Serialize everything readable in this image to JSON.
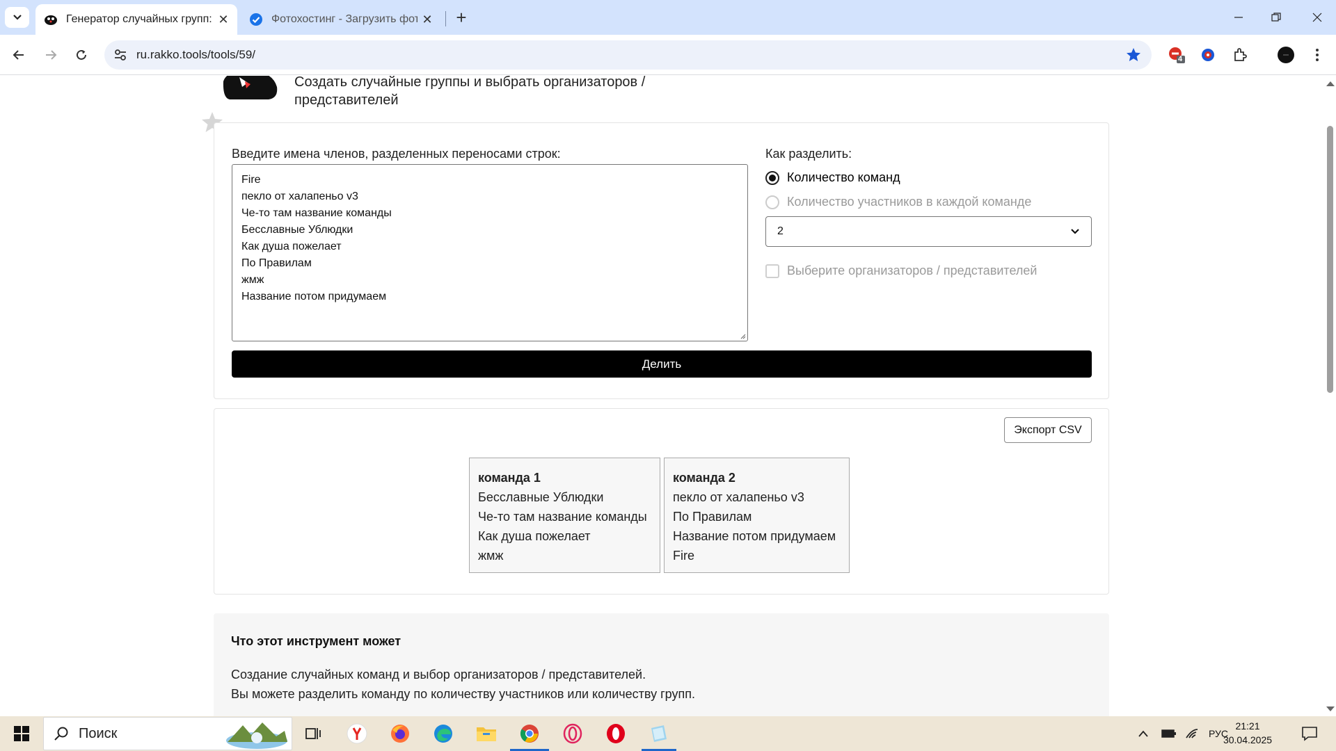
{
  "browser": {
    "tabs": [
      {
        "title": "Генератор случайных групп: б",
        "active": true
      },
      {
        "title": "Фотохостинг - Загрузить фото",
        "active": false
      }
    ],
    "url": "ru.rakko.tools/tools/59/",
    "extension_badge": "4"
  },
  "page": {
    "subtitle_line1": "Создать случайные группы и выбрать организаторов /",
    "subtitle_line2": "представителей",
    "form": {
      "names_label": "Введите имена членов, разделенных переносами строк:",
      "names": [
        "Fire",
        "пекло от халапеньо v3",
        "Че-то там название команды",
        "Бесславные Ублюдки",
        "Как душа пожелает",
        "По Правилам",
        "жмж",
        "Название потом придумаем"
      ],
      "split_label": "Как разделить:",
      "option_teams": "Количество команд",
      "option_members": "Количество участников в каждой команде",
      "selected_option": "Количество команд",
      "count_value": "2",
      "organizers_label": "Выберите организаторов / представителей",
      "organizers_checked": false,
      "divide_button": "Делить"
    },
    "result": {
      "export_button": "Экспорт CSV",
      "teams": [
        {
          "name": "команда 1",
          "members": [
            "Бесславные Ублюдки",
            "Че-то там название команды",
            "Как душа пожелает",
            "жмж"
          ]
        },
        {
          "name": "команда 2",
          "members": [
            "пекло от халапеньо v3",
            "По Правилам",
            "Название потом придумаем",
            "Fire"
          ]
        }
      ]
    },
    "info": {
      "heading": "Что этот инструмент может",
      "line1": "Создание случайных команд и выбор организаторов / представителей.",
      "line2": "Вы можете разделить команду по количеству участников или количеству групп."
    }
  },
  "taskbar": {
    "search_placeholder": "Поиск",
    "language": "РУС",
    "time": "21:21",
    "date": "30.04.2025"
  },
  "colors": {
    "tabstrip": "#d3e3fd",
    "accent": "#1e66c9",
    "button_bg": "#000000",
    "taskbar": "#eee6d6"
  },
  "icons": [
    "tab-search-icon",
    "close-icon",
    "plus-icon",
    "minimize-icon",
    "maximize-icon",
    "back-icon",
    "forward-icon",
    "reload-icon",
    "site-settings-icon",
    "bookmark-star-icon",
    "extensions-icon",
    "profile-icon",
    "menu-icon",
    "windows-start-icon",
    "search-icon",
    "task-view-icon"
  ]
}
